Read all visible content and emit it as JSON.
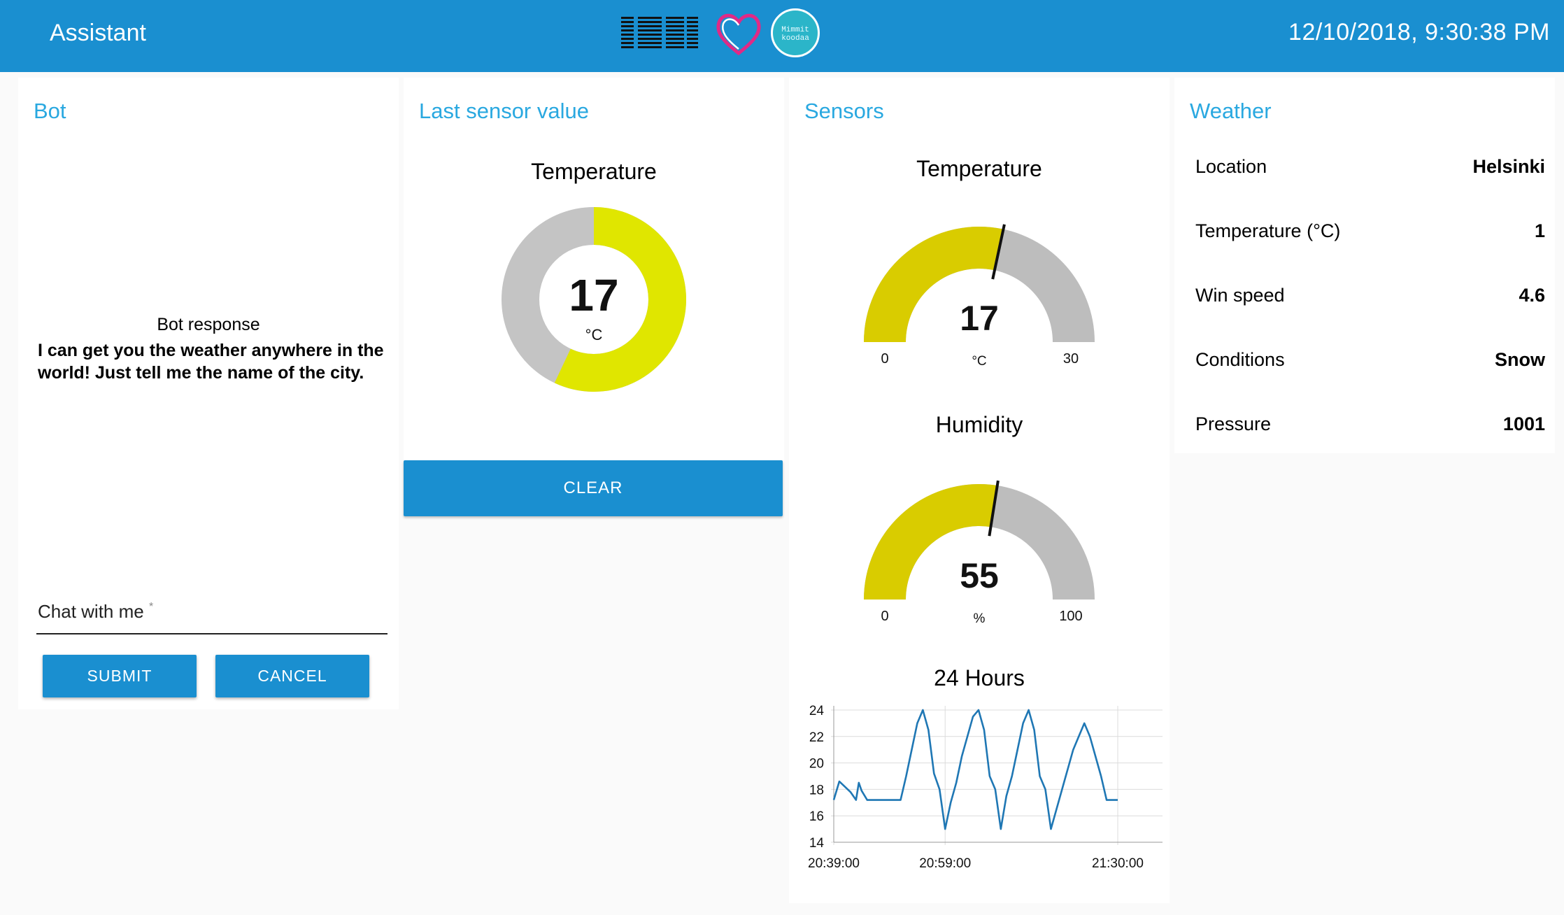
{
  "header": {
    "title": "Assistant",
    "datetime": "12/10/2018, 9:30:38 PM",
    "badge_text": "Mimmit koodaa"
  },
  "bot": {
    "title": "Bot",
    "response_label": "Bot response",
    "response_text": "I can get you the weather anywhere in the world! Just tell me the name of the city.",
    "chat_label": "Chat with me",
    "chat_required": "*",
    "submit_label": "SUBMIT",
    "cancel_label": "CANCEL"
  },
  "last_sensor": {
    "title": "Last sensor value",
    "gauge_title": "Temperature",
    "value": "17",
    "unit": "°C",
    "fraction": 0.57,
    "clear_label": "CLEAR"
  },
  "sensors": {
    "title": "Sensors",
    "temperature": {
      "title": "Temperature",
      "value": "17",
      "unit": "°C",
      "min": "0",
      "max": "30",
      "fraction": 0.567
    },
    "humidity": {
      "title": "Humidity",
      "value": "55",
      "unit": "%",
      "min": "0",
      "max": "100",
      "fraction": 0.55
    }
  },
  "weather": {
    "title": "Weather",
    "rows": [
      {
        "label": "Location",
        "value": "Helsinki"
      },
      {
        "label": "Temperature (°C)",
        "value": "1"
      },
      {
        "label": "Win speed",
        "value": "4.6"
      },
      {
        "label": "Conditions",
        "value": "Snow"
      },
      {
        "label": "Pressure",
        "value": "1001"
      }
    ]
  },
  "chart_data": {
    "type": "line",
    "title": "24 Hours",
    "xlabel": "",
    "ylabel": "",
    "ylim": [
      14,
      24
    ],
    "yticks": [
      "24",
      "22",
      "20",
      "18",
      "16",
      "14"
    ],
    "xtick_labels": [
      "20:39:00",
      "20:59:00",
      "21:30:00"
    ],
    "xtick_positions": [
      0,
      20,
      51
    ],
    "grid": true,
    "series": [
      {
        "color": "#1f77b4",
        "x": [
          0,
          1,
          3,
          4,
          4.5,
          5,
          6,
          7,
          9,
          12,
          13,
          14,
          15,
          16,
          17,
          18,
          19,
          20,
          21,
          22,
          23,
          24,
          25,
          26,
          27,
          28,
          29,
          30,
          31,
          32,
          33,
          34,
          35,
          36,
          37,
          38,
          39,
          40,
          41,
          42,
          43,
          44,
          45,
          46,
          47,
          48,
          49,
          50,
          51
        ],
        "values": [
          17.2,
          18.6,
          17.8,
          17.2,
          18.5,
          17.9,
          17.2,
          17.2,
          17.2,
          17.2,
          19.0,
          21.0,
          23.0,
          24.0,
          22.5,
          19.2,
          18.0,
          15.0,
          17.0,
          18.5,
          20.5,
          22.0,
          23.5,
          24.0,
          22.5,
          19.0,
          18.0,
          15.0,
          17.5,
          19.0,
          21.0,
          23.0,
          24.0,
          22.5,
          19.0,
          18.0,
          15.0,
          16.5,
          18.0,
          19.5,
          21.0,
          22.0,
          23.0,
          22.0,
          20.5,
          19.0,
          17.2,
          17.2,
          17.2
        ]
      }
    ]
  }
}
